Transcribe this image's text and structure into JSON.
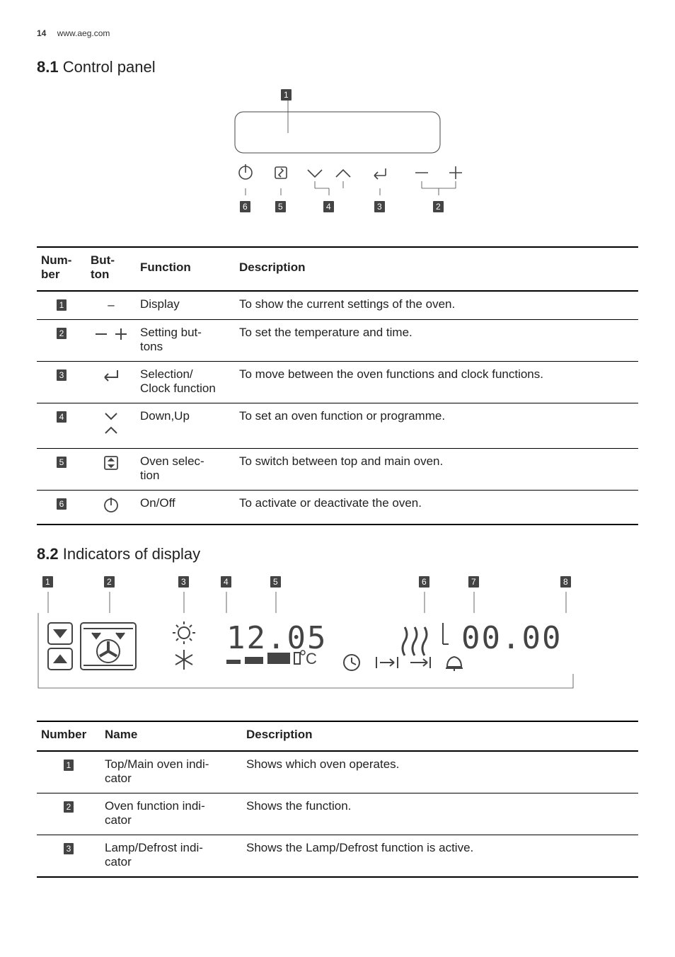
{
  "header": {
    "page_number": "14",
    "site": "www.aeg.com"
  },
  "section1": {
    "num": "8.1",
    "title": "Control panel"
  },
  "section2": {
    "num": "8.2",
    "title": "Indicators of display"
  },
  "diagram1": {
    "callouts": [
      "1",
      "2",
      "3",
      "4",
      "5",
      "6"
    ]
  },
  "diagram2": {
    "callouts": [
      "1",
      "2",
      "3",
      "4",
      "5",
      "6",
      "7",
      "8"
    ],
    "time": "12.05",
    "duration": "00.00"
  },
  "table1": {
    "head": {
      "number": "Num-\nber",
      "button": "But-\nton",
      "function": "Function",
      "description": "Description"
    },
    "rows": [
      {
        "num": "1",
        "btn": "–",
        "fun": "Display",
        "desc": "To show the current settings of the oven."
      },
      {
        "num": "2",
        "btn": "minusplus",
        "fun": "Setting but-\ntons",
        "desc": "To set the temperature and time."
      },
      {
        "num": "3",
        "btn": "enter",
        "fun": "Selection/\nClock function",
        "desc": "To move between the oven functions and clock functions."
      },
      {
        "num": "4",
        "btn": "downup",
        "fun": "Down,Up",
        "desc": "To set an oven function or programme."
      },
      {
        "num": "5",
        "btn": "ovensel",
        "fun": "Oven selec-\ntion",
        "desc": "To switch between top and main oven."
      },
      {
        "num": "6",
        "btn": "power",
        "fun": "On/Off",
        "desc": "To activate or deactivate the oven."
      }
    ]
  },
  "table2": {
    "head": {
      "number": "Number",
      "name": "Name",
      "description": "Description"
    },
    "rows": [
      {
        "num": "1",
        "name": "Top/Main oven indi-\ncator",
        "desc": "Shows which oven operates."
      },
      {
        "num": "2",
        "name": "Oven function indi-\ncator",
        "desc": "Shows the function."
      },
      {
        "num": "3",
        "name": "Lamp/Defrost indi-\ncator",
        "desc": "Shows the Lamp/Defrost function is active."
      }
    ]
  }
}
